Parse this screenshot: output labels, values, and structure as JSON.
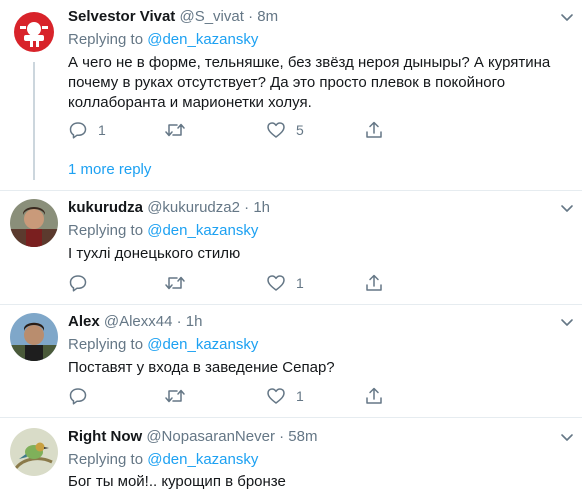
{
  "tweets": [
    {
      "name": "Selvestor Vivat",
      "handle": "@S_vivat",
      "sep": "·",
      "time": "8m",
      "replying_prefix": "Replying to",
      "replying_to": "@den_kazansky",
      "text": "А чего не в форме, тельняшке, без звёзд нероя дыныры? А курятина почему в руках отсутствует? Да это просто плевок в покойного коллаборанта и марионетки холуя.",
      "reply_count": "1",
      "retweet_count": "",
      "like_count": "5",
      "more_replies": "1 more reply"
    },
    {
      "name": "kukurudza",
      "handle": "@kukurudza2",
      "sep": "·",
      "time": "1h",
      "replying_prefix": "Replying to",
      "replying_to": "@den_kazansky",
      "text": "І тухлі донецького стилю",
      "reply_count": "",
      "retweet_count": "",
      "like_count": "1"
    },
    {
      "name": "Alex",
      "handle": "@Alexx44",
      "sep": "·",
      "time": "1h",
      "replying_prefix": "Replying to",
      "replying_to": "@den_kazansky",
      "text": "Поставят у входа в заведение Сепар?",
      "reply_count": "",
      "retweet_count": "",
      "like_count": "1"
    },
    {
      "name": "Right Now",
      "handle": "@NopasaranNever",
      "sep": "·",
      "time": "58m",
      "replying_prefix": "Replying to",
      "replying_to": "@den_kazansky",
      "text": "Бог ты мой!.. курощип в бронзе"
    }
  ],
  "colors": {
    "accent": "#1da1f2",
    "muted": "#657786",
    "text": "#14171a",
    "divider": "#e6ecf0"
  },
  "icons": [
    "reply-icon",
    "retweet-icon",
    "like-icon",
    "share-icon",
    "chevron-down-icon"
  ]
}
